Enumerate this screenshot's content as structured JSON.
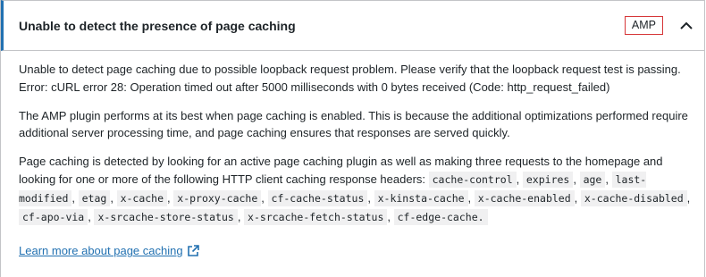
{
  "header": {
    "title": "Unable to detect the presence of page caching",
    "badge": "AMP",
    "toggle_icon": "chevron-up-icon"
  },
  "body": {
    "paragraph1": "Unable to detect page caching due to possible loopback request problem. Please verify that the loopback request test is passing. Error: cURL error 28: Operation timed out after 5000 milliseconds with 0 bytes received (Code: http_request_failed)",
    "paragraph2": "The AMP plugin performs at its best when page caching is enabled. This is because the additional optimizations performed require additional server processing time, and page caching ensures that responses are served quickly.",
    "paragraph3_intro": "Page caching is detected by looking for an active page caching plugin as well as making three requests to the homepage and looking for one or more of the following HTTP client caching response headers: ",
    "headers": [
      "cache-control",
      "expires",
      "age",
      "last-modified",
      "etag",
      "x-cache",
      "x-proxy-cache",
      "cf-cache-status",
      "x-kinsta-cache",
      "x-cache-enabled",
      "x-cache-disabled",
      "cf-apo-via",
      "x-srcache-store-status",
      "x-srcache-fetch-status",
      "cf-edge-cache."
    ],
    "separator": ", ",
    "learn_more": "Learn more about page caching",
    "learn_more_icon": "external-link-icon"
  },
  "colors": {
    "accent": "#2271b1",
    "badge_border": "#d63638",
    "border": "#c3c4c7",
    "code_bg": "#f0f0f1",
    "text": "#1d2327"
  }
}
